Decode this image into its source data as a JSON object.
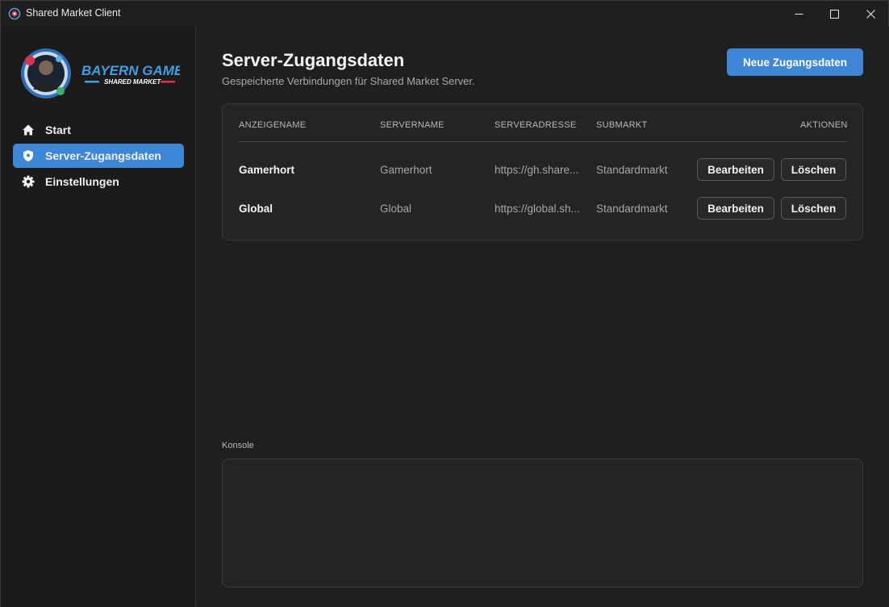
{
  "window": {
    "title": "Shared Market Client"
  },
  "sidebar": {
    "logo": {
      "text_top": "BAYERN GAMERS",
      "text_bottom": "SHARED MARKET"
    },
    "items": [
      {
        "label": "Start",
        "icon": "home-icon",
        "active": false
      },
      {
        "label": "Server-Zugangsdaten",
        "icon": "shield-icon",
        "active": true
      },
      {
        "label": "Einstellungen",
        "icon": "gear-icon",
        "active": false
      }
    ]
  },
  "main": {
    "title": "Server-Zugangsdaten",
    "subtitle": "Gespeicherte Verbindungen für Shared Market Server.",
    "new_button": "Neue Zugangsdaten",
    "table": {
      "headers": [
        "ANZEIGENAME",
        "SERVERNAME",
        "SERVERADRESSE",
        "SUBMARKT",
        "AKTIONEN"
      ],
      "rows": [
        {
          "display_name": "Gamerhort",
          "server_name": "Gamerhort",
          "address": "https://gh.share...",
          "submarket": "Standardmarkt",
          "edit": "Bearbeiten",
          "delete": "Löschen"
        },
        {
          "display_name": "Global",
          "server_name": "Global",
          "address": "https://global.sh...",
          "submarket": "Standardmarkt",
          "edit": "Bearbeiten",
          "delete": "Löschen"
        }
      ]
    },
    "console": {
      "label": "Konsole",
      "content": ""
    }
  },
  "colors": {
    "accent": "#3e86d6",
    "background": "#201f1d",
    "sidebar": "#1c1b1a",
    "card": "#252422"
  }
}
